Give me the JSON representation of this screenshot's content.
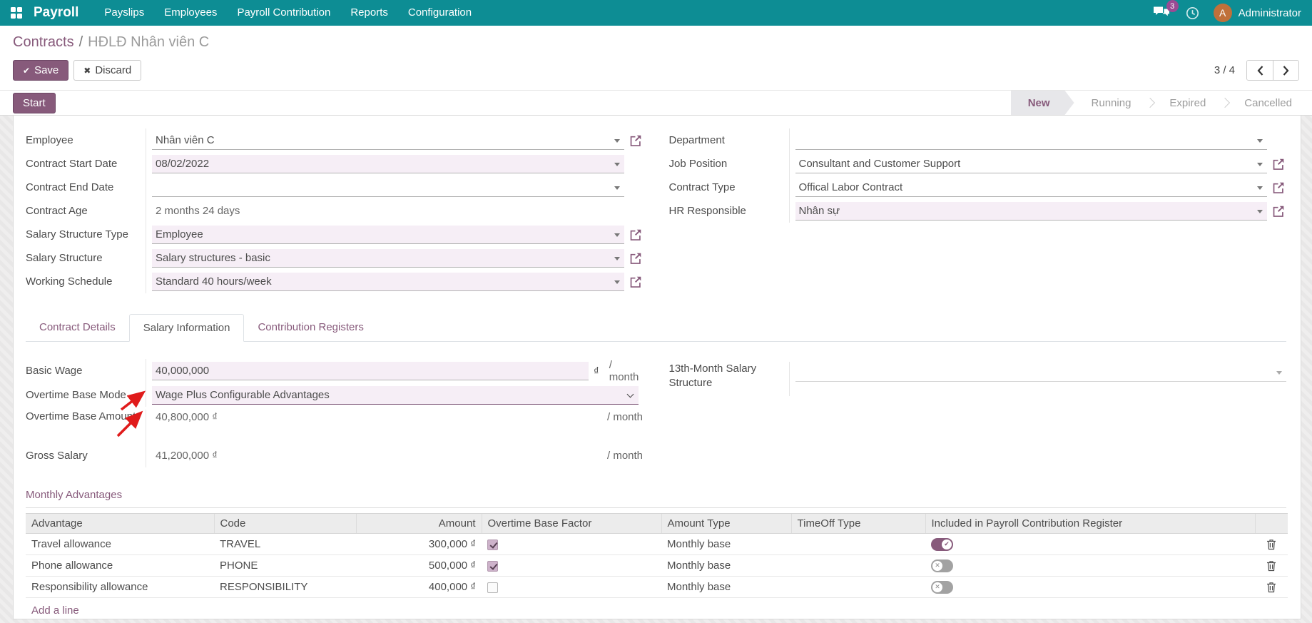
{
  "nav": {
    "app_name": "Payroll",
    "items": [
      "Payslips",
      "Employees",
      "Payroll Contribution",
      "Reports",
      "Configuration"
    ],
    "messages_badge": "3",
    "user_initial": "A",
    "user_name": "Administrator"
  },
  "breadcrumb": {
    "parent": "Contracts",
    "separator": "/",
    "current": "HĐLĐ Nhân viên C"
  },
  "control": {
    "save": "Save",
    "discard": "Discard",
    "pager_count": "3 / 4"
  },
  "icons": {
    "check": "✔",
    "times": "✖"
  },
  "statusbar": {
    "start_button": "Start",
    "stages": [
      {
        "label": "New",
        "active": true
      },
      {
        "label": "Running",
        "active": false
      },
      {
        "label": "Expired",
        "active": false
      },
      {
        "label": "Cancelled",
        "active": false
      }
    ]
  },
  "form": {
    "left": {
      "employee": {
        "label": "Employee",
        "value": "Nhân viên C"
      },
      "contract_start_date": {
        "label": "Contract Start Date",
        "value": "08/02/2022"
      },
      "contract_end_date": {
        "label": "Contract End Date",
        "value": ""
      },
      "contract_age": {
        "label": "Contract Age",
        "value": "2 months 24 days"
      },
      "salary_structure_type": {
        "label": "Salary Structure Type",
        "value": "Employee"
      },
      "salary_structure": {
        "label": "Salary Structure",
        "value": "Salary structures - basic"
      },
      "working_schedule": {
        "label": "Working Schedule",
        "value": "Standard 40 hours/week"
      }
    },
    "right": {
      "department": {
        "label": "Department",
        "value": ""
      },
      "job_position": {
        "label": "Job Position",
        "value": "Consultant and Customer Support"
      },
      "contract_type": {
        "label": "Contract Type",
        "value": "Offical Labor Contract"
      },
      "hr_responsible": {
        "label": "HR Responsible",
        "value": "Nhân sự"
      }
    }
  },
  "tabs": {
    "items": [
      {
        "label": "Contract Details",
        "active": false
      },
      {
        "label": "Salary Information",
        "active": true
      },
      {
        "label": "Contribution Registers",
        "active": false
      }
    ]
  },
  "salary": {
    "per_month": "/ month",
    "basic_wage": {
      "label": "Basic Wage",
      "value": "40,000,000",
      "currency": "₫"
    },
    "overtime_base_mode": {
      "label": "Overtime Base Mode",
      "value": "Wage Plus Configurable Advantages"
    },
    "overtime_base_amount": {
      "label": "Overtime Base Amount",
      "value": "40,800,000 ₫"
    },
    "gross_salary": {
      "label": "Gross Salary",
      "value": "41,200,000 ₫"
    },
    "thirteenth_month": {
      "label": "13th-Month Salary Structure",
      "value": ""
    }
  },
  "advantages": {
    "title": "Monthly Advantages",
    "columns": [
      "Advantage",
      "Code",
      "Amount",
      "Overtime Base Factor",
      "Amount Type",
      "TimeOff Type",
      "Included in Payroll Contribution Register"
    ],
    "rows": [
      {
        "advantage": "Travel allowance",
        "code": "TRAVEL",
        "amount": "300,000 ₫",
        "overtime_base_factor": true,
        "amount_type": "Monthly base",
        "timeoff_type": "",
        "included": true
      },
      {
        "advantage": "Phone allowance",
        "code": "PHONE",
        "amount": "500,000 ₫",
        "overtime_base_factor": true,
        "amount_type": "Monthly base",
        "timeoff_type": "",
        "included": false
      },
      {
        "advantage": "Responsibility allowance",
        "code": "RESPONSIBILITY",
        "amount": "400,000 ₫",
        "overtime_base_factor": false,
        "amount_type": "Monthly base",
        "timeoff_type": "",
        "included": false
      }
    ],
    "add_line": "Add a line"
  },
  "colors": {
    "navbar": "#0d8d94",
    "accent": "#875A7B",
    "badge": "#9b4a94",
    "avatar": "#c0703a",
    "field_highlight": "#f6eef6",
    "annotation_arrow": "#e01b1b"
  }
}
